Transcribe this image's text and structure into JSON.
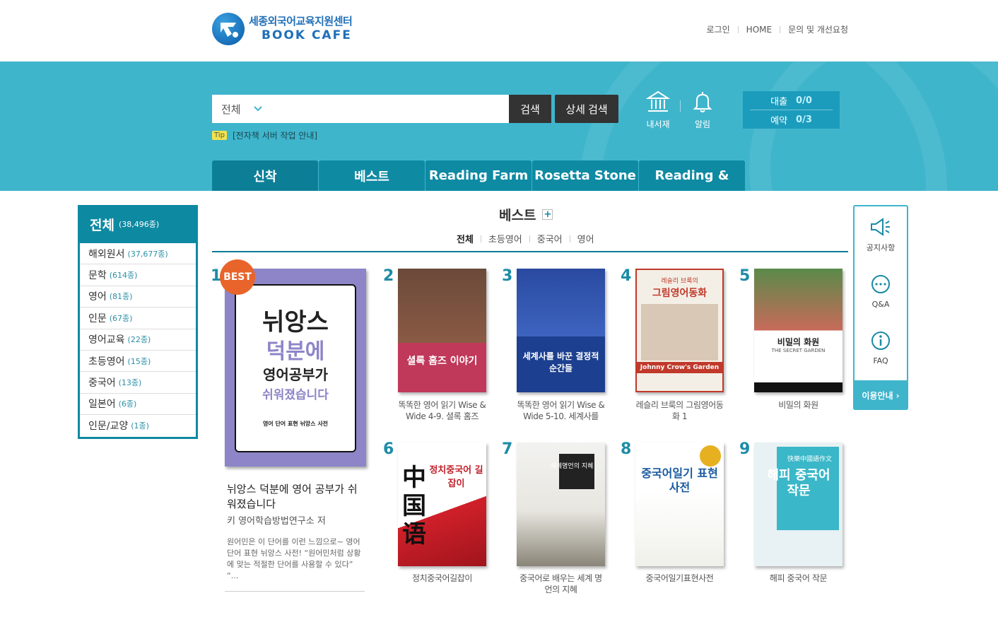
{
  "header": {
    "logo_title": "세종외국어교육지원센터",
    "logo_sub": "BOOK CAFE",
    "links": [
      "로그인",
      "HOME",
      "문의 및 개선요청"
    ]
  },
  "search": {
    "scope": "전체",
    "placeholder": "",
    "search_btn": "검색",
    "advanced_btn": "상세 검색",
    "tip_badge": "Tip",
    "tip_text": "[전자책 서버 작업 안내]"
  },
  "quick": {
    "mylib": "내서재",
    "alarm": "알림"
  },
  "loan": {
    "loan_label": "대출",
    "loan_value": "0/0",
    "reserve_label": "예약",
    "reserve_value": "0/3"
  },
  "tabs": [
    "신착",
    "베스트",
    "Reading Farm",
    "Rosetta Stone",
    "Reading &"
  ],
  "sidebar": {
    "title": "전체",
    "count": "(38,496종)",
    "items": [
      {
        "label": "해외원서",
        "count": "(37,677종)"
      },
      {
        "label": "문학",
        "count": "(614종)"
      },
      {
        "label": "영어",
        "count": "(81종)"
      },
      {
        "label": "인문",
        "count": "(67종)"
      },
      {
        "label": "영어교육",
        "count": "(22종)"
      },
      {
        "label": "초등영어",
        "count": "(15종)"
      },
      {
        "label": "중국어",
        "count": "(13종)"
      },
      {
        "label": "일본어",
        "count": "(6종)"
      },
      {
        "label": "인문/교양",
        "count": "(1종)"
      }
    ]
  },
  "section": {
    "title": "베스트",
    "plus": "+",
    "subtabs": [
      "전체",
      "초등영어",
      "중국어",
      "영어"
    ]
  },
  "best": {
    "badge": "BEST",
    "rank": "1",
    "cover_lines": [
      "뉘앙스",
      "덕분에",
      "영어공부가",
      "쉬워졌습니다",
      "영어 단어 표현 뉘앙스 사전"
    ],
    "title": "뉘앙스 덕분에 영어 공부가 쉬워졌습니다",
    "author": "키 영어학습방법연구소 저",
    "desc": "원어민은 이 단어를 이런 느낌으로~ 영어 단어 표현 뉘앙스 사전! “원어민처럼 상황에 맞는 적절한 단어를 사용할 수 있다” “..."
  },
  "books": [
    {
      "rank": "2",
      "cover": "셜록 홈즈 이야기",
      "caption": "똑똑한 영어 읽기 Wise & Wide 4-9. 셜록 홈즈"
    },
    {
      "rank": "3",
      "cover": "세계사를 바꾼 결정적 순간들",
      "caption": "똑똑한 영어 읽기 Wise & Wide 5-10. 세계사를"
    },
    {
      "rank": "4",
      "cover": "그림영어동화",
      "cover_top": "레슬리 브룩의",
      "cover_sub": "Johnny Crow's Garden",
      "caption": "레슬리 브룩의 그림영어동화 1"
    },
    {
      "rank": "5",
      "cover": "비밀의 화원",
      "cover_sub": "THE SECRET GARDEN",
      "caption": "비밀의 화원"
    },
    {
      "rank": "6",
      "cover": "정치중국어 길잡이",
      "cover_big": "中国语",
      "caption": "정치중국어길잡이"
    },
    {
      "rank": "7",
      "cover": "세계명언의 지혜",
      "caption": "중국어로 배우는 세계 명언의 지혜"
    },
    {
      "rank": "8",
      "cover": "중국어일기 표현사전",
      "caption": "중국어일기표현사전"
    },
    {
      "rank": "9",
      "cover": "해피 중국어 작문",
      "cover_top": "快樂中國語作文",
      "caption": "해피 중국어 작문"
    }
  ],
  "widget": {
    "notice": "공지사항",
    "qna": "Q&A",
    "faq": "FAQ",
    "guide": "이용안내 ›"
  }
}
